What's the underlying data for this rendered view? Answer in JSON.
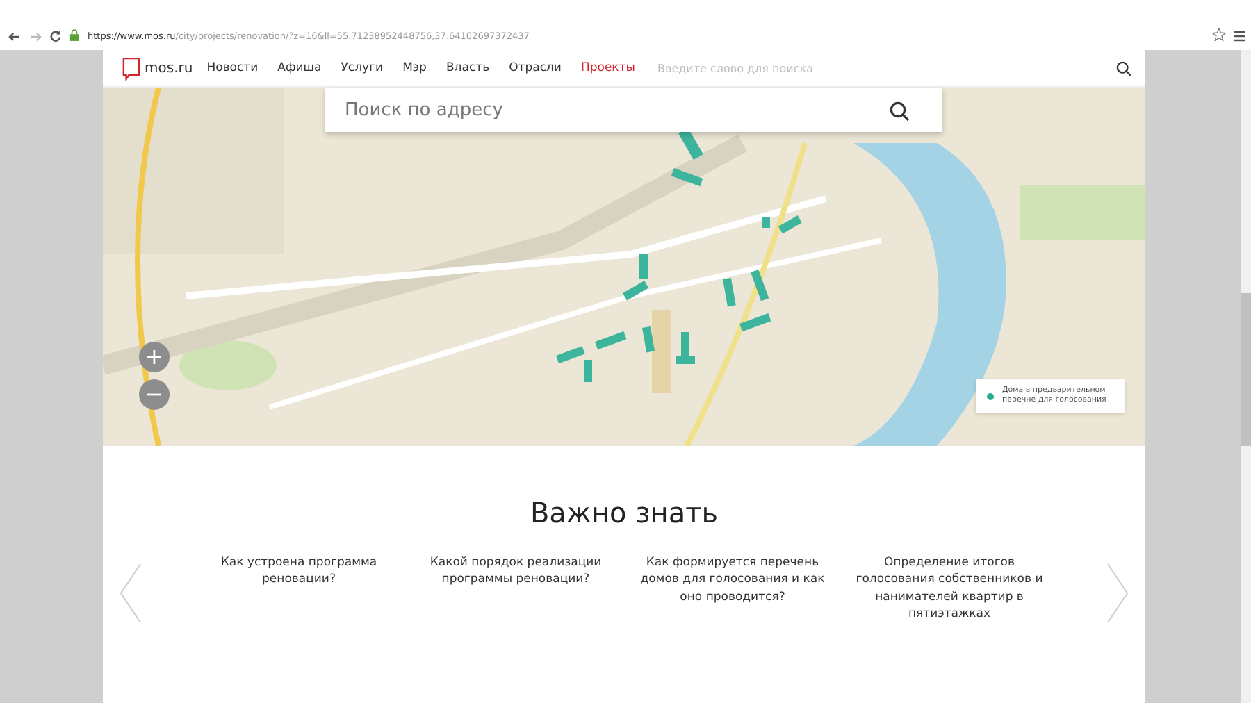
{
  "browser": {
    "url_host": "https://www.mos.ru",
    "url_path": "/city/projects/renovation/?z=16&ll=55.71238952448756,37.64102697372437"
  },
  "site_header": {
    "logo": "mos.ru",
    "nav": [
      {
        "label": "Новости",
        "selected": false
      },
      {
        "label": "Афиша",
        "selected": false
      },
      {
        "label": "Услуги",
        "selected": false
      },
      {
        "label": "Мэр",
        "selected": false
      },
      {
        "label": "Власть",
        "selected": false
      },
      {
        "label": "Отрасли",
        "selected": false
      },
      {
        "label": "Проекты",
        "selected": true
      }
    ],
    "search": {
      "placeholder": "Введите слово для поиска"
    }
  },
  "map": {
    "search": {
      "placeholder": "Поиск по адресу"
    },
    "zoom_in": "+",
    "zoom_out": "−",
    "legend": [
      {
        "label": "Дома в предварительном перечне для голосования",
        "color": "#2bab8f"
      }
    ]
  },
  "important": {
    "title": "Важно знать",
    "cards": [
      "Как устроена программа реновации?",
      "Какой порядок реализации программы реновации?",
      "Как формируется перечень домов для голосования и как оно проводится?",
      "Определение итогов голосования собственников и нанимателей квартир в пятиэтажках"
    ]
  }
}
